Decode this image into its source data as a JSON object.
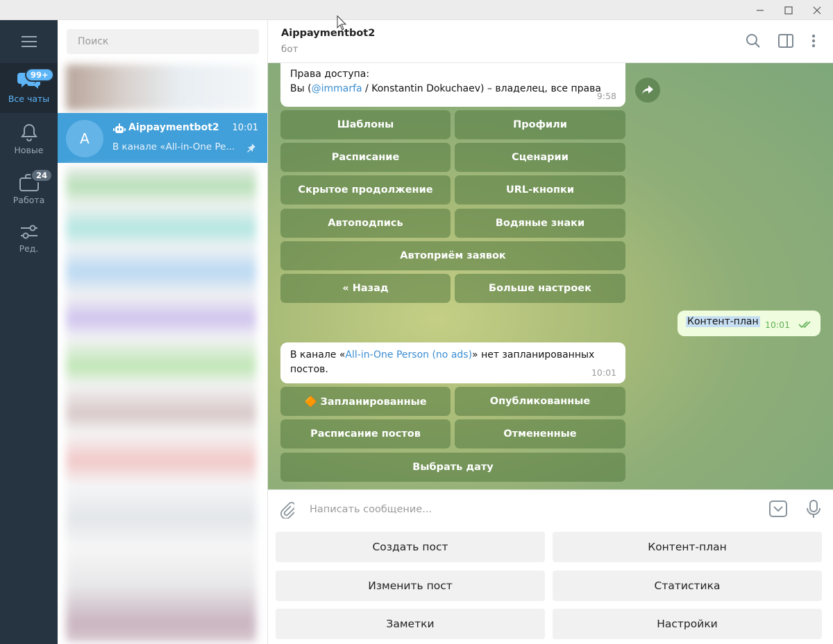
{
  "window": {
    "controls": [
      "minimize-icon",
      "maximize-icon",
      "close-icon"
    ]
  },
  "rail": {
    "items": [
      {
        "label": "Все чаты",
        "badge": "99+",
        "icon": "chats-icon",
        "active": true
      },
      {
        "label": "Новые",
        "icon": "bell-icon"
      },
      {
        "label": "Работа",
        "badge": "24",
        "icon": "briefcase-icon"
      },
      {
        "label": "Ред.",
        "icon": "sliders-icon"
      }
    ]
  },
  "chatlist": {
    "search_placeholder": "Поиск",
    "active_chat": {
      "avatar": "A",
      "name": "Aippaymentbot2",
      "time": "10:01",
      "preview": "В канале «All-in-One Pe..."
    }
  },
  "header": {
    "title": "Aippaymentbot2",
    "subtitle": "бот"
  },
  "messages": {
    "access": {
      "line1": "Права доступа:",
      "you": "Вы (",
      "username": "@immarfa",
      "rest": " / Konstantin Dokuchaev) – владелец, все права",
      "time": "9:58"
    },
    "inline_kb1": [
      [
        "Шаблоны",
        "Профили"
      ],
      [
        "Расписание",
        "Сценарии"
      ],
      [
        "Скрытое продолжение",
        "URL-кнопки"
      ],
      [
        "Автоподпись",
        "Водяные знаки"
      ],
      [
        "Автоприём заявок"
      ],
      [
        "« Назад",
        "Больше настроек"
      ]
    ],
    "outgoing": {
      "text": "Контент-план",
      "time": "10:01"
    },
    "no_posts": {
      "prefix": "В канале «",
      "channel": "All-in-One Person (no ads)",
      "suffix": "» нет запланированных",
      "line2": "постов.",
      "time": "10:01"
    },
    "inline_kb2": [
      [
        "🔶 Запланированные",
        "Опубликованные"
      ],
      [
        "Расписание постов",
        "Отмененные"
      ],
      [
        "Выбрать дату"
      ]
    ]
  },
  "input": {
    "placeholder": "Написать сообщение..."
  },
  "reply_keyboard": [
    [
      "Создать пост",
      "Контент-план"
    ],
    [
      "Изменить пост",
      "Статистика"
    ],
    [
      "Заметки",
      "Настройки"
    ]
  ],
  "colors": {
    "accent": "#419fd9",
    "rail": "#263340",
    "badge": "#5eb5f7",
    "outgoing": "#effdde"
  }
}
